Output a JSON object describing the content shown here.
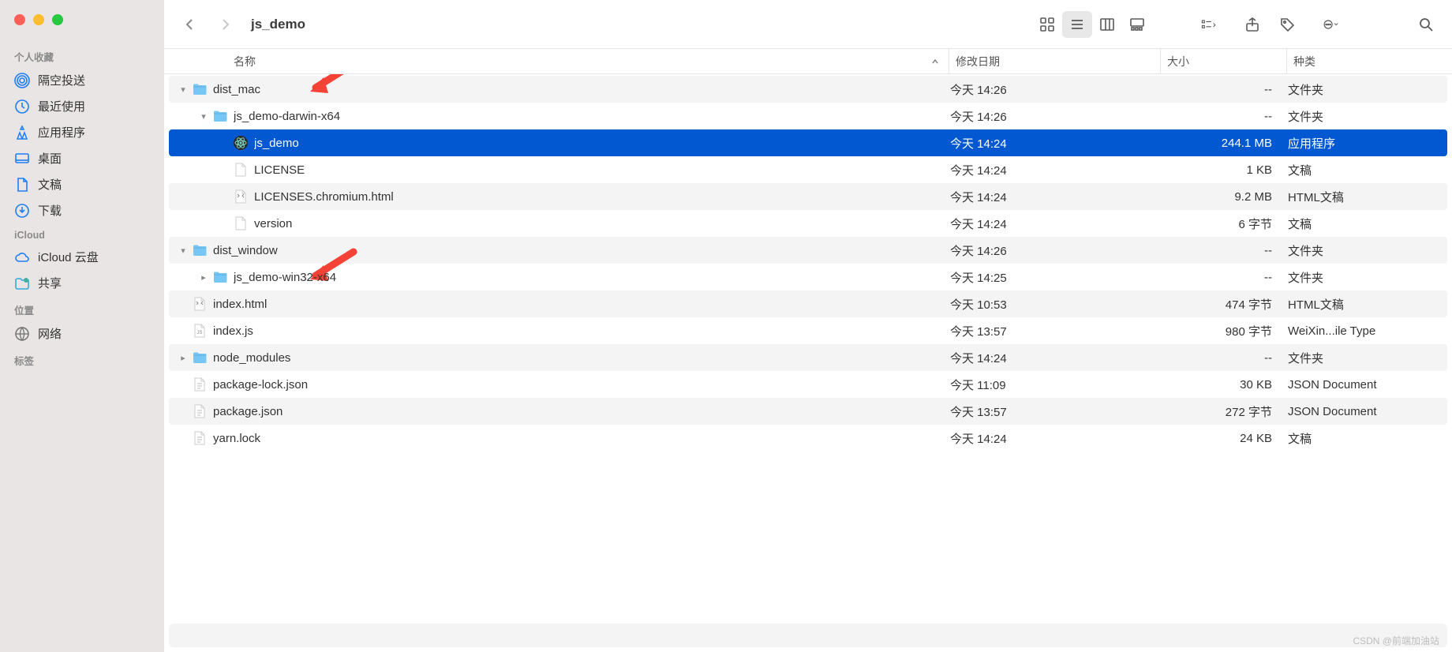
{
  "window": {
    "title": "js_demo"
  },
  "sidebar": {
    "sections": [
      {
        "title": "个人收藏",
        "items": [
          {
            "icon": "airdrop",
            "label": "隔空投送"
          },
          {
            "icon": "clock",
            "label": "最近使用"
          },
          {
            "icon": "apps",
            "label": "应用程序"
          },
          {
            "icon": "desktop",
            "label": "桌面"
          },
          {
            "icon": "doc",
            "label": "文稿"
          },
          {
            "icon": "download",
            "label": "下载"
          }
        ]
      },
      {
        "title": "iCloud",
        "items": [
          {
            "icon": "cloud",
            "label": "iCloud 云盘"
          },
          {
            "icon": "shared",
            "label": "共享"
          }
        ]
      },
      {
        "title": "位置",
        "items": [
          {
            "icon": "network",
            "label": "网络"
          }
        ]
      },
      {
        "title": "标签",
        "items": []
      }
    ]
  },
  "columns": {
    "name": "名称",
    "date": "修改日期",
    "size": "大小",
    "kind": "种类"
  },
  "rows": [
    {
      "indent": 0,
      "disclosure": "down",
      "icon": "folder",
      "name": "dist_mac",
      "date": "今天 14:26",
      "size": "--",
      "kind": "文件夹",
      "stripe": true,
      "arrow": true
    },
    {
      "indent": 1,
      "disclosure": "down",
      "icon": "folder",
      "name": "js_demo-darwin-x64",
      "date": "今天 14:26",
      "size": "--",
      "kind": "文件夹",
      "stripe": false
    },
    {
      "indent": 2,
      "disclosure": "",
      "icon": "app",
      "name": "js_demo",
      "date": "今天 14:24",
      "size": "244.1 MB",
      "kind": "应用程序",
      "selected": true
    },
    {
      "indent": 2,
      "disclosure": "",
      "icon": "blank",
      "name": "LICENSE",
      "date": "今天 14:24",
      "size": "1 KB",
      "kind": "文稿",
      "stripe": false
    },
    {
      "indent": 2,
      "disclosure": "",
      "icon": "html",
      "name": "LICENSES.chromium.html",
      "date": "今天 14:24",
      "size": "9.2 MB",
      "kind": "HTML文稿",
      "stripe": true
    },
    {
      "indent": 2,
      "disclosure": "",
      "icon": "blank",
      "name": "version",
      "date": "今天 14:24",
      "size": "6 字节",
      "kind": "文稿",
      "stripe": false
    },
    {
      "indent": 0,
      "disclosure": "down",
      "icon": "folder",
      "name": "dist_window",
      "date": "今天 14:26",
      "size": "--",
      "kind": "文件夹",
      "stripe": true,
      "arrow": true
    },
    {
      "indent": 1,
      "disclosure": "right",
      "icon": "folder",
      "name": "js_demo-win32-x64",
      "date": "今天 14:25",
      "size": "--",
      "kind": "文件夹",
      "stripe": false
    },
    {
      "indent": 0,
      "disclosure": "",
      "icon": "html",
      "name": "index.html",
      "date": "今天 10:53",
      "size": "474 字节",
      "kind": "HTML文稿",
      "stripe": true
    },
    {
      "indent": 0,
      "disclosure": "",
      "icon": "js",
      "name": "index.js",
      "date": "今天 13:57",
      "size": "980 字节",
      "kind": "WeiXin...ile Type",
      "stripe": false
    },
    {
      "indent": 0,
      "disclosure": "right",
      "icon": "folder",
      "name": "node_modules",
      "date": "今天 14:24",
      "size": "--",
      "kind": "文件夹",
      "stripe": true
    },
    {
      "indent": 0,
      "disclosure": "",
      "icon": "text",
      "name": "package-lock.json",
      "date": "今天 11:09",
      "size": "30 KB",
      "kind": "JSON Document",
      "stripe": false
    },
    {
      "indent": 0,
      "disclosure": "",
      "icon": "text",
      "name": "package.json",
      "date": "今天 13:57",
      "size": "272 字节",
      "kind": "JSON Document",
      "stripe": true
    },
    {
      "indent": 0,
      "disclosure": "",
      "icon": "text",
      "name": "yarn.lock",
      "date": "今天 14:24",
      "size": "24 KB",
      "kind": "文稿",
      "stripe": false
    }
  ],
  "watermark": "CSDN @前端加油站",
  "colors": {
    "accent": "#0158d0",
    "sidebar_icon": "#1e7ef7",
    "arrow": "#f44336"
  }
}
